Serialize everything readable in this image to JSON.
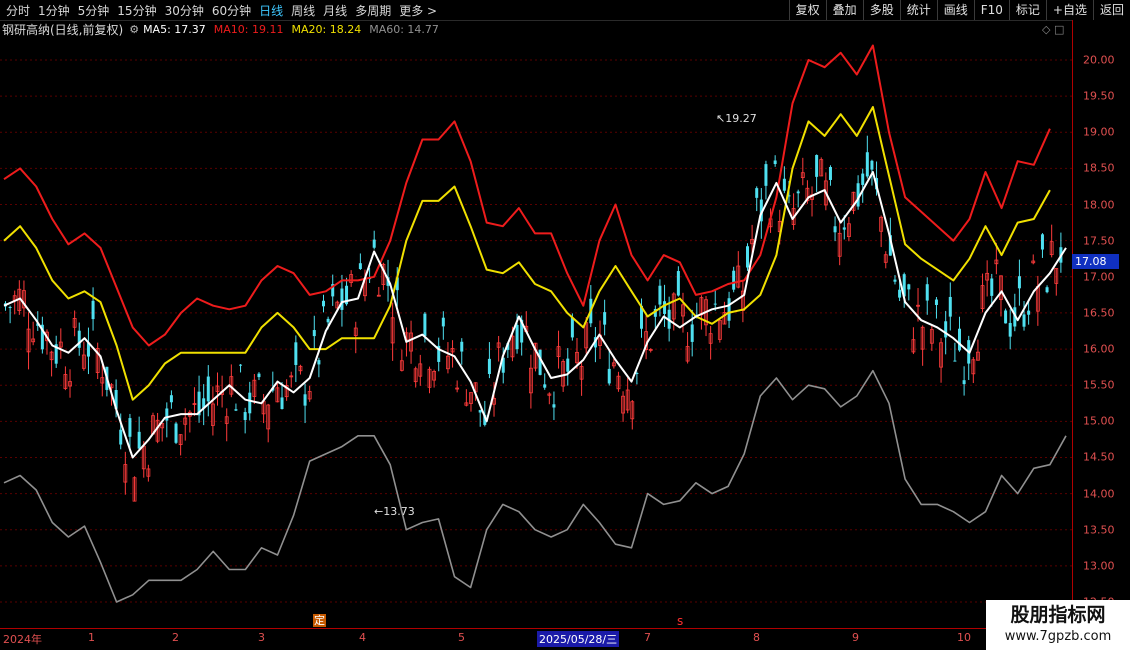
{
  "toolbar": {
    "periods": [
      "分时",
      "1分钟",
      "5分钟",
      "15分钟",
      "30分钟",
      "60分钟",
      "日线",
      "周线",
      "月线",
      "多周期",
      "更多 >"
    ],
    "active_period": "日线",
    "actions": [
      "复权",
      "叠加",
      "多股",
      "统计",
      "画线",
      "F10",
      "标记",
      "+自选",
      "返回"
    ]
  },
  "legend": {
    "stock": "钢研高纳(日线,前复权)",
    "gear_icon": "gear-icon",
    "ma5": "MA5: 17.37",
    "ma10": "MA10: 19.11",
    "ma20": "MA20: 18.24",
    "ma60": "MA60: 14.77"
  },
  "colors": {
    "up": "#ff3b3b",
    "down": "#4fe0f0",
    "ma5": "#ffffff",
    "ma10": "#ee1c1c",
    "ma20": "#f0e000",
    "ma60": "#909090",
    "axis": "#b00000"
  },
  "price_axis": {
    "ticks": [
      "20.00",
      "19.50",
      "19.00",
      "18.50",
      "18.00",
      "17.50",
      "17.00",
      "16.50",
      "16.00",
      "15.50",
      "15.00",
      "14.50",
      "14.00",
      "13.50",
      "13.00",
      "12.50"
    ],
    "current": "17.08"
  },
  "annotations": {
    "high": "19.27",
    "low": "13.73"
  },
  "markers": {
    "ding": "定",
    "s": "s"
  },
  "date_axis": {
    "labels": [
      "2024年",
      "1",
      "2",
      "3",
      "4",
      "5",
      "2025/05/28/三",
      "7",
      "8",
      "9",
      "10"
    ]
  },
  "watermark": {
    "line1": "股朋指标网",
    "line2": "www.7gpzb.com"
  },
  "chart_data": {
    "type": "candlestick",
    "price_min": 12.5,
    "price_max": 20.0,
    "series": [
      {
        "name": "MA10",
        "color": "#ee1c1c",
        "values": [
          18.35,
          18.5,
          18.25,
          17.8,
          17.45,
          17.6,
          17.4,
          16.85,
          16.3,
          16.05,
          16.2,
          16.5,
          16.7,
          16.6,
          16.55,
          16.6,
          16.95,
          17.15,
          17.05,
          16.75,
          16.8,
          16.95,
          16.95,
          17.0,
          17.5,
          18.3,
          18.9,
          18.9,
          19.15,
          18.6,
          17.75,
          17.7,
          17.95,
          17.6,
          17.6,
          17.05,
          16.6,
          17.5,
          18.0,
          17.3,
          16.95,
          17.3,
          17.2,
          16.75,
          16.8,
          16.9,
          16.95,
          17.3,
          18.1,
          19.4,
          20.0,
          19.9,
          20.1,
          19.8,
          20.2,
          19.0,
          18.1,
          17.9,
          17.7,
          17.5,
          17.8,
          18.45,
          17.95,
          18.6,
          18.55,
          19.05
        ]
      },
      {
        "name": "MA20",
        "color": "#f0e000",
        "values": [
          17.5,
          17.7,
          17.4,
          16.95,
          16.7,
          16.8,
          16.65,
          16.05,
          15.3,
          15.5,
          15.8,
          15.95,
          15.95,
          15.95,
          15.95,
          15.95,
          16.3,
          16.5,
          16.3,
          16.0,
          16.0,
          16.15,
          16.15,
          16.15,
          16.6,
          17.5,
          18.05,
          18.05,
          18.25,
          17.7,
          17.1,
          17.05,
          17.2,
          16.9,
          16.8,
          16.5,
          16.3,
          16.8,
          17.15,
          16.8,
          16.45,
          16.6,
          16.7,
          16.45,
          16.35,
          16.5,
          16.55,
          16.75,
          17.3,
          18.5,
          19.15,
          18.95,
          19.25,
          18.95,
          19.35,
          18.4,
          17.45,
          17.25,
          17.1,
          16.95,
          17.25,
          17.7,
          17.3,
          17.75,
          17.8,
          18.2
        ]
      },
      {
        "name": "MA5",
        "color": "#ffffff",
        "values": [
          16.6,
          16.7,
          16.4,
          16.05,
          15.95,
          16.15,
          15.9,
          15.15,
          14.5,
          14.75,
          15.05,
          15.1,
          15.1,
          15.3,
          15.5,
          15.3,
          15.25,
          15.55,
          15.4,
          15.6,
          16.25,
          16.65,
          16.7,
          17.35,
          16.9,
          16.1,
          16.2,
          16.0,
          15.9,
          15.55,
          15.0,
          15.9,
          16.45,
          16.0,
          15.6,
          15.65,
          15.85,
          16.2,
          15.85,
          15.55,
          16.1,
          16.45,
          16.3,
          16.45,
          16.55,
          16.6,
          16.75,
          17.85,
          18.3,
          17.8,
          18.1,
          18.2,
          17.75,
          18.05,
          18.45,
          17.6,
          16.65,
          16.4,
          16.3,
          16.15,
          15.95,
          16.5,
          16.8,
          16.4,
          16.8,
          17.05,
          17.4
        ]
      },
      {
        "name": "MA60",
        "color": "#909090",
        "values": [
          14.15,
          14.25,
          14.05,
          13.6,
          13.4,
          13.55,
          13.05,
          12.5,
          12.6,
          12.8,
          12.8,
          12.8,
          12.95,
          13.2,
          12.95,
          12.95,
          13.25,
          13.15,
          13.7,
          14.45,
          14.55,
          14.65,
          14.8,
          14.8,
          14.4,
          13.5,
          13.6,
          13.65,
          12.85,
          12.7,
          13.5,
          13.85,
          13.75,
          13.5,
          13.4,
          13.5,
          13.85,
          13.6,
          13.3,
          13.25,
          14.0,
          13.85,
          13.9,
          14.15,
          14.0,
          14.1,
          14.55,
          15.35,
          15.6,
          15.3,
          15.5,
          15.45,
          15.2,
          15.35,
          15.7,
          15.25,
          14.2,
          13.85,
          13.85,
          13.75,
          13.6,
          13.75,
          14.25,
          14.0,
          14.35,
          14.4,
          14.8
        ]
      }
    ]
  }
}
